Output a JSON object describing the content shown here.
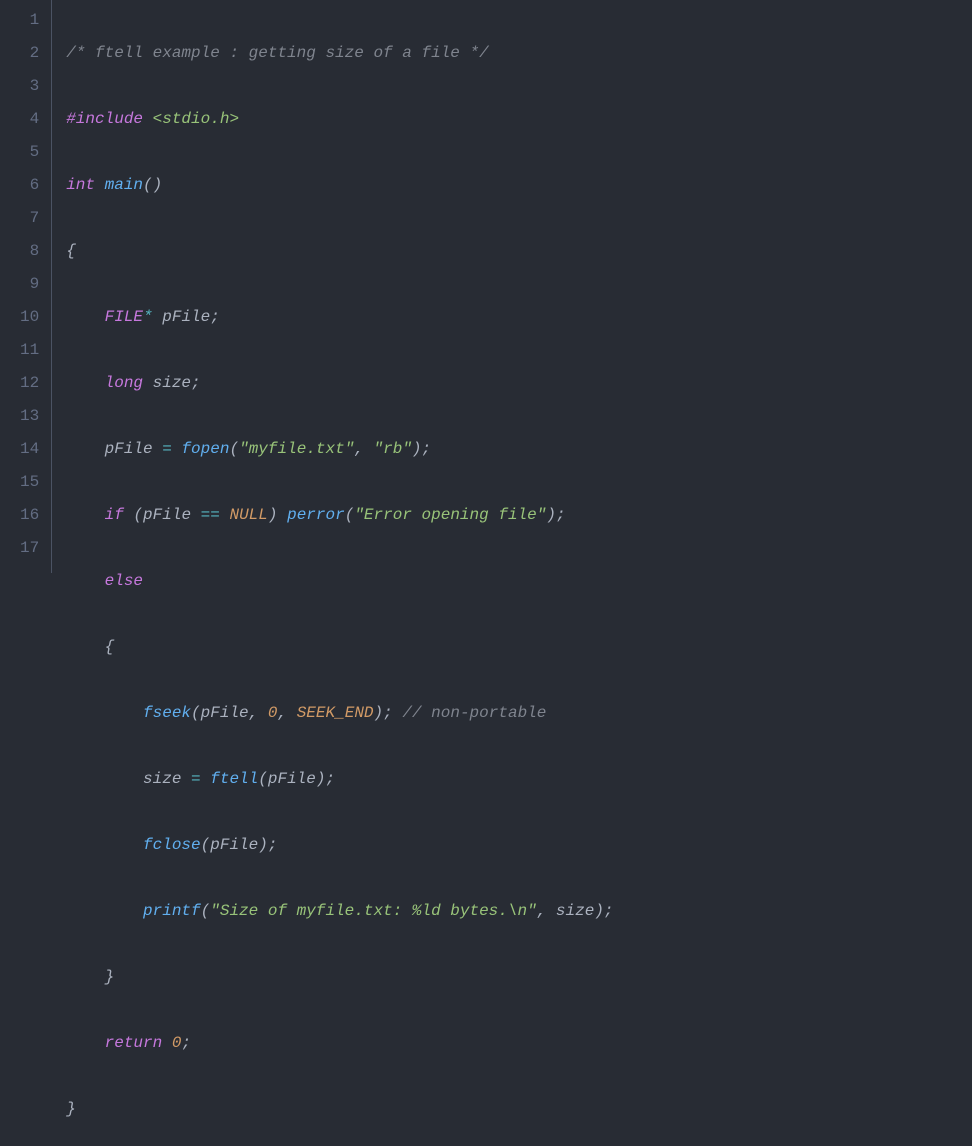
{
  "lines": {
    "l1_comment": "/* ftell example : getting size of a file */",
    "l2_include": "#include",
    "l2_header": "<stdio.h>",
    "l3_int": "int",
    "l3_main": "main",
    "l3_parens": "()",
    "l4_brace": "{",
    "l5_FILE": "FILE",
    "l5_star": "*",
    "l5_pFile": "pFile",
    "l5_semi": ";",
    "l6_long": "long",
    "l6_size": "size",
    "l6_semi": ";",
    "l7_pFile": "pFile",
    "l7_eq": "=",
    "l7_fopen": "fopen",
    "l7_open": "(",
    "l7_str1": "\"myfile.txt\"",
    "l7_comma": ",",
    "l7_str2": "\"rb\"",
    "l7_close": ")",
    "l7_semi": ";",
    "l8_if": "if",
    "l8_open": "(",
    "l8_pFile": "pFile",
    "l8_eqeq": "==",
    "l8_NULL": "NULL",
    "l8_close": ")",
    "l8_perror": "perror",
    "l8_open2": "(",
    "l8_str": "\"Error opening file\"",
    "l8_close2": ")",
    "l8_semi": ";",
    "l9_else": "else",
    "l10_brace": "{",
    "l11_fseek": "fseek",
    "l11_open": "(",
    "l11_pFile": "pFile",
    "l11_c1": ",",
    "l11_zero": "0",
    "l11_c2": ",",
    "l11_SEEK_END": "SEEK_END",
    "l11_close": ")",
    "l11_semi": ";",
    "l11_comment": "// non-portable",
    "l12_size": "size",
    "l12_eq": "=",
    "l12_ftell": "ftell",
    "l12_open": "(",
    "l12_pFile": "pFile",
    "l12_close": ")",
    "l12_semi": ";",
    "l13_fclose": "fclose",
    "l13_open": "(",
    "l13_pFile": "pFile",
    "l13_close": ")",
    "l13_semi": ";",
    "l14_printf": "printf",
    "l14_open": "(",
    "l14_str": "\"Size of myfile.txt: %ld bytes.\\n\"",
    "l14_comma": ",",
    "l14_size": "size",
    "l14_close": ")",
    "l14_semi": ";",
    "l15_brace": "}",
    "l16_return": "return",
    "l16_zero": "0",
    "l16_semi": ";",
    "l17_brace": "}"
  },
  "linenumbers": [
    "1",
    "2",
    "3",
    "4",
    "5",
    "6",
    "7",
    "8",
    "9",
    "10",
    "11",
    "12",
    "13",
    "14",
    "15",
    "16",
    "17"
  ]
}
